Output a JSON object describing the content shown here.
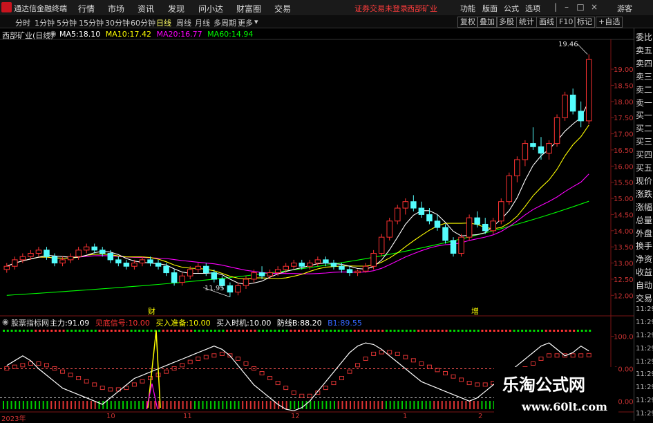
{
  "menubar": {
    "app_title": "通达信金融终端",
    "menus": [
      "行情",
      "市场",
      "资讯",
      "发现",
      "问小达",
      "财富圈",
      "交易"
    ],
    "warning": "证券交易未登录",
    "stock_name": "西部矿业",
    "right_menus": [
      "功能",
      "版面",
      "公式",
      "选项"
    ],
    "guest": "游客"
  },
  "periods": {
    "items": [
      "分时",
      "1分钟",
      "5分钟",
      "15分钟",
      "30分钟",
      "60分钟",
      "日线",
      "周线",
      "月线",
      "多周期",
      "更多"
    ],
    "active": "日线"
  },
  "toolbar_right": [
    "复权",
    "叠加",
    "多股",
    "统计",
    "画线",
    "F10",
    "标记",
    "+自选"
  ],
  "info": {
    "title": "西部矿业(日线)",
    "ma": [
      {
        "label": "MA5:",
        "value": "18.10",
        "color": "#ffffff"
      },
      {
        "label": "MA10:",
        "value": "17.42",
        "color": "#ffff00"
      },
      {
        "label": "MA20:",
        "value": "16.77",
        "color": "#ff00ff"
      },
      {
        "label": "MA60:",
        "value": "14.94",
        "color": "#00ff00"
      }
    ]
  },
  "price_axis": [
    "19.00",
    "18.50",
    "18.00",
    "17.50",
    "17.00",
    "16.50",
    "16.00",
    "15.50",
    "15.00",
    "14.50",
    "14.00",
    "13.50",
    "13.00",
    "12.50",
    "12.00"
  ],
  "annotations": {
    "high": "19.46",
    "low": "11.95",
    "mark_cai": "财",
    "mark_zeng": "增"
  },
  "indicator": {
    "name": "股票指标网",
    "items": [
      {
        "label": "主力:",
        "value": "91.09",
        "color": "#ffffff"
      },
      {
        "label": "见底信号:",
        "value": "10.00",
        "color": "#ff3333"
      },
      {
        "label": "买入准备:",
        "value": "10.00",
        "color": "#ffff00"
      },
      {
        "label": "买入时机:",
        "value": "10.00",
        "color": "#ffffff"
      },
      {
        "label": "防线B:",
        "value": "88.20",
        "color": "#ffffff"
      },
      {
        "label": "B1:",
        "value": "89.55",
        "color": "#3366ff"
      }
    ],
    "axis": [
      "100.0",
      "80.00",
      "60.00"
    ]
  },
  "right_panel": [
    "委比",
    "卖五",
    "卖四",
    "卖三",
    "卖二",
    "卖一",
    "买一",
    "买二",
    "买三",
    "买四",
    "买五",
    "现价",
    "涨跌",
    "涨幅",
    "总量",
    "外盘",
    "换手",
    "净资",
    "收益",
    "自动",
    "交易",
    "11:29",
    "11:29",
    "11:29",
    "11:29",
    "11:29",
    "11:29",
    "11:29",
    "11:29",
    "11:29"
  ],
  "date_axis": [
    "2023年",
    "10",
    "11",
    "12",
    "1",
    "2"
  ],
  "watermark": {
    "title": "乐淘公式网",
    "url": "www.60lt.com"
  },
  "chart_data": {
    "type": "candlestick",
    "ylim": [
      11.6,
      19.9
    ],
    "candles": [
      [
        12.8,
        13.0,
        12.7,
        12.9
      ],
      [
        12.9,
        13.2,
        12.8,
        13.1
      ],
      [
        13.1,
        13.3,
        13.0,
        13.2
      ],
      [
        13.2,
        13.4,
        13.1,
        13.3
      ],
      [
        13.3,
        13.5,
        13.2,
        13.4
      ],
      [
        13.4,
        13.5,
        13.1,
        13.2
      ],
      [
        13.2,
        13.3,
        12.9,
        13.0
      ],
      [
        13.0,
        13.2,
        12.9,
        13.1
      ],
      [
        13.1,
        13.3,
        13.0,
        13.2
      ],
      [
        13.2,
        13.5,
        13.1,
        13.4
      ],
      [
        13.4,
        13.6,
        13.3,
        13.5
      ],
      [
        13.5,
        13.6,
        13.3,
        13.4
      ],
      [
        13.4,
        13.5,
        13.2,
        13.3
      ],
      [
        13.3,
        13.4,
        13.0,
        13.1
      ],
      [
        13.1,
        13.2,
        12.9,
        13.0
      ],
      [
        13.0,
        13.1,
        12.8,
        12.9
      ],
      [
        12.9,
        13.1,
        12.8,
        13.0
      ],
      [
        13.0,
        13.2,
        12.9,
        13.1
      ],
      [
        13.1,
        13.2,
        12.9,
        13.0
      ],
      [
        13.0,
        13.1,
        12.8,
        12.9
      ],
      [
        12.9,
        13.0,
        12.6,
        12.7
      ],
      [
        12.7,
        12.8,
        12.3,
        12.4
      ],
      [
        12.4,
        12.7,
        12.3,
        12.6
      ],
      [
        12.6,
        12.9,
        12.5,
        12.8
      ],
      [
        12.8,
        13.0,
        12.7,
        12.9
      ],
      [
        12.9,
        13.0,
        12.6,
        12.7
      ],
      [
        12.7,
        12.8,
        12.4,
        12.5
      ],
      [
        12.5,
        12.6,
        12.2,
        12.3
      ],
      [
        12.3,
        12.4,
        11.95,
        12.1
      ],
      [
        12.1,
        12.4,
        12.0,
        12.3
      ],
      [
        12.3,
        12.6,
        12.2,
        12.5
      ],
      [
        12.5,
        12.8,
        12.4,
        12.7
      ],
      [
        12.7,
        12.9,
        12.5,
        12.6
      ],
      [
        12.6,
        12.8,
        12.5,
        12.7
      ],
      [
        12.7,
        12.9,
        12.6,
        12.8
      ],
      [
        12.8,
        13.0,
        12.7,
        12.9
      ],
      [
        12.9,
        13.1,
        12.8,
        13.0
      ],
      [
        13.0,
        13.1,
        12.8,
        12.9
      ],
      [
        12.9,
        13.1,
        12.8,
        13.0
      ],
      [
        13.0,
        13.2,
        12.9,
        13.1
      ],
      [
        13.1,
        13.2,
        12.9,
        13.0
      ],
      [
        13.0,
        13.1,
        12.8,
        12.9
      ],
      [
        12.9,
        13.0,
        12.7,
        12.8
      ],
      [
        12.8,
        12.9,
        12.6,
        12.7
      ],
      [
        12.7,
        12.8,
        12.6,
        12.75
      ],
      [
        12.75,
        13.0,
        12.7,
        12.9
      ],
      [
        12.9,
        13.4,
        12.8,
        13.3
      ],
      [
        13.3,
        13.9,
        13.2,
        13.8
      ],
      [
        13.8,
        14.4,
        13.7,
        14.3
      ],
      [
        14.3,
        14.8,
        14.2,
        14.7
      ],
      [
        14.7,
        15.0,
        14.5,
        14.9
      ],
      [
        14.9,
        15.1,
        14.6,
        14.7
      ],
      [
        14.7,
        14.9,
        14.4,
        14.5
      ],
      [
        14.5,
        14.7,
        14.2,
        14.3
      ],
      [
        14.3,
        14.5,
        14.0,
        14.1
      ],
      [
        14.1,
        14.2,
        13.6,
        13.7
      ],
      [
        13.7,
        13.8,
        13.2,
        13.3
      ],
      [
        13.3,
        13.9,
        13.2,
        13.8
      ],
      [
        13.8,
        14.5,
        13.7,
        14.4
      ],
      [
        14.4,
        14.6,
        14.1,
        14.2
      ],
      [
        14.2,
        14.4,
        13.9,
        14.0
      ],
      [
        14.0,
        14.4,
        13.9,
        14.3
      ],
      [
        14.3,
        15.0,
        14.2,
        14.9
      ],
      [
        14.9,
        15.8,
        14.8,
        15.7
      ],
      [
        15.7,
        16.3,
        15.5,
        16.2
      ],
      [
        16.2,
        16.8,
        16.0,
        16.7
      ],
      [
        16.7,
        17.2,
        16.5,
        16.6
      ],
      [
        16.6,
        16.9,
        16.2,
        16.4
      ],
      [
        16.4,
        16.8,
        16.2,
        16.7
      ],
      [
        16.7,
        17.6,
        16.6,
        17.5
      ],
      [
        17.5,
        18.3,
        17.4,
        18.2
      ],
      [
        18.2,
        18.4,
        17.6,
        17.7
      ],
      [
        17.7,
        18.0,
        17.2,
        17.4
      ],
      [
        17.4,
        19.46,
        17.3,
        19.3
      ]
    ],
    "ma_colors": {
      "ma5": "#ffffff",
      "ma10": "#ffff00",
      "ma20": "#ff00ff",
      "ma60": "#00ff00"
    },
    "indicator_ylim": [
      55,
      105
    ],
    "main_line": [
      82,
      85,
      88,
      85,
      80,
      76,
      72,
      68,
      66,
      64,
      62,
      60,
      58,
      62,
      66,
      70,
      74,
      76,
      78,
      80,
      82,
      84,
      86,
      88,
      90,
      92,
      94,
      92,
      88,
      82,
      76,
      70,
      66,
      62,
      58,
      55,
      54,
      56,
      60,
      66,
      72,
      78,
      84,
      90,
      94,
      96,
      95,
      92,
      88,
      84,
      80,
      76,
      72,
      70,
      68,
      66,
      64,
      62,
      60,
      62,
      66,
      70,
      74,
      78,
      82,
      86,
      90,
      94,
      96,
      92,
      88,
      90,
      94,
      91
    ],
    "defense_line": [
      80,
      81,
      82,
      83,
      83,
      82,
      80,
      78,
      76,
      74,
      72,
      70,
      68,
      67,
      67,
      68,
      70,
      72,
      74,
      76,
      78,
      80,
      82,
      84,
      86,
      87,
      88,
      89,
      88,
      86,
      83,
      80,
      77,
      74,
      71,
      68,
      65,
      63,
      63,
      65,
      68,
      71,
      74,
      78,
      82,
      86,
      89,
      90,
      90,
      89,
      87,
      85,
      83,
      81,
      79,
      77,
      75,
      73,
      71,
      70,
      70,
      71,
      73,
      75,
      77,
      80,
      83,
      86,
      88,
      88,
      88,
      88,
      88,
      88.2
    ]
  }
}
